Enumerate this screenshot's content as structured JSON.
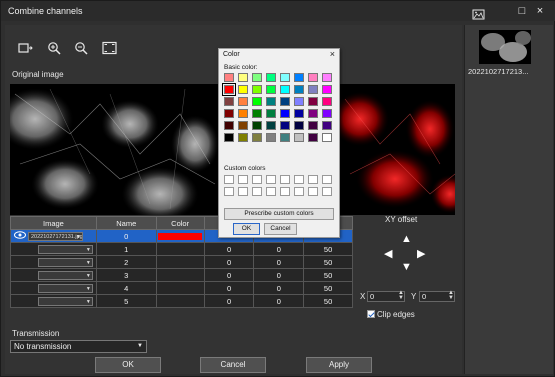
{
  "window": {
    "title": "Combine channels",
    "controls": [
      "□",
      "×"
    ]
  },
  "toolbar": {
    "icons": [
      "fit-window-icon",
      "zoom-in-icon",
      "zoom-out-icon",
      "fullscreen-icon"
    ]
  },
  "original_image_label": "Original image",
  "table": {
    "headers": [
      "Image",
      "Name",
      "Color",
      "X",
      "Y",
      "Brightness"
    ],
    "headers_visible": [
      "Image",
      "Name",
      "Color",
      "X",
      "",
      "ss"
    ],
    "rows": [
      {
        "image": "20221027172131.jpg",
        "name": "0",
        "color": "#ff0000",
        "x": "",
        "y": "",
        "brightness": "",
        "selected": true
      },
      {
        "image": "",
        "name": "1",
        "color": "",
        "x": "0",
        "y": "0",
        "brightness": "50",
        "selected": false
      },
      {
        "image": "",
        "name": "2",
        "color": "",
        "x": "0",
        "y": "0",
        "brightness": "50",
        "selected": false
      },
      {
        "image": "",
        "name": "3",
        "color": "",
        "x": "0",
        "y": "0",
        "brightness": "50",
        "selected": false
      },
      {
        "image": "",
        "name": "4",
        "color": "",
        "x": "0",
        "y": "0",
        "brightness": "50",
        "selected": false
      },
      {
        "image": "",
        "name": "5",
        "color": "",
        "x": "0",
        "y": "0",
        "brightness": "50",
        "selected": false
      }
    ]
  },
  "xy_offset": {
    "label": "XY offset",
    "x_label": "X",
    "x_value": "0",
    "y_label": "Y",
    "y_value": "0",
    "clip_edges_label": "Clip edges",
    "clip_edges_checked": true
  },
  "transmission": {
    "label": "Transmission",
    "value": "No transmission"
  },
  "buttons": {
    "ok": "OK",
    "cancel": "Cancel",
    "apply": "Apply"
  },
  "sidebar": {
    "thumbnail_label": "2022102717213..."
  },
  "color_dialog": {
    "title": "Color",
    "basic_label": "Basic color:",
    "custom_label": "Custom colors",
    "prescribe_label": "Prescribe custom colors",
    "ok": "OK",
    "cancel": "Cancel",
    "basic_colors": [
      "#ff8080",
      "#ffff80",
      "#80ff80",
      "#00ff80",
      "#80ffff",
      "#0080ff",
      "#ff80c0",
      "#ff80ff",
      "#ff0000",
      "#ffff00",
      "#80ff00",
      "#00ff40",
      "#00ffff",
      "#0080c0",
      "#8080c0",
      "#ff00ff",
      "#804040",
      "#ff8040",
      "#00ff00",
      "#008080",
      "#004080",
      "#8080ff",
      "#800040",
      "#ff0080",
      "#800000",
      "#ff8000",
      "#008000",
      "#008040",
      "#0000ff",
      "#0000a0",
      "#800080",
      "#8000ff",
      "#400000",
      "#804000",
      "#004000",
      "#004040",
      "#000080",
      "#000040",
      "#400040",
      "#400080",
      "#000000",
      "#808000",
      "#808040",
      "#808080",
      "#408080",
      "#c0c0c0",
      "#400040",
      "#ffffff"
    ],
    "selected_index": 8
  }
}
